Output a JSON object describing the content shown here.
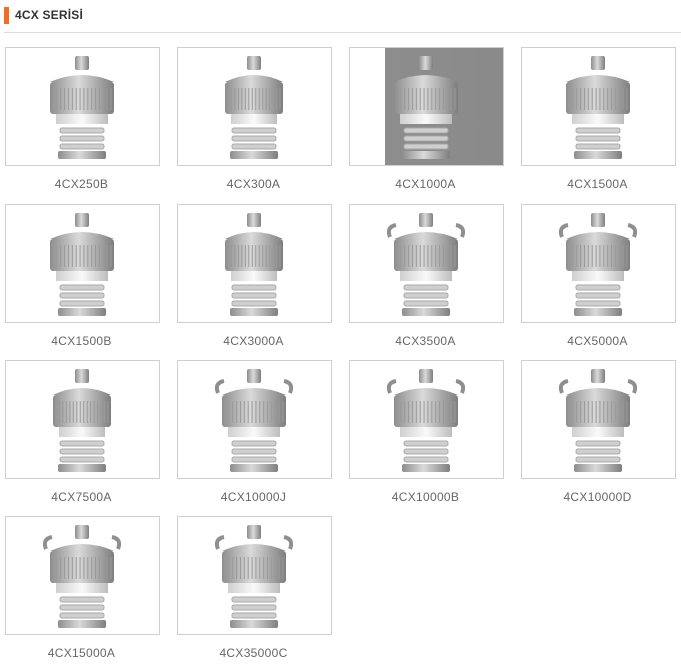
{
  "section": {
    "title": "4CX SERİSİ",
    "accent_color": "#f26c21"
  },
  "products": [
    {
      "name": "4CX250B",
      "icon": "tube-4cx250b-icon",
      "dark_bg": false
    },
    {
      "name": "4CX300A",
      "icon": "tube-4cx300a-icon",
      "dark_bg": false
    },
    {
      "name": "4CX1000A",
      "icon": "tube-4cx1000a-icon",
      "dark_bg": true
    },
    {
      "name": "4CX1500A",
      "icon": "tube-4cx1500a-icon",
      "dark_bg": false
    },
    {
      "name": "4CX1500B",
      "icon": "tube-4cx1500b-icon",
      "dark_bg": false
    },
    {
      "name": "4CX3000A",
      "icon": "tube-4cx3000a-icon",
      "dark_bg": false
    },
    {
      "name": "4CX3500A",
      "icon": "tube-4cx3500a-icon",
      "dark_bg": false
    },
    {
      "name": "4CX5000A",
      "icon": "tube-4cx5000a-icon",
      "dark_bg": false
    },
    {
      "name": "4CX7500A",
      "icon": "tube-4cx7500a-icon",
      "dark_bg": false
    },
    {
      "name": "4CX10000J",
      "icon": "tube-4cx10000j-icon",
      "dark_bg": false
    },
    {
      "name": "4CX10000B",
      "icon": "tube-4cx10000b-icon",
      "dark_bg": false
    },
    {
      "name": "4CX10000D",
      "icon": "tube-4cx10000d-icon",
      "dark_bg": false
    },
    {
      "name": "4CX15000A",
      "icon": "tube-4cx15000a-icon",
      "dark_bg": false
    },
    {
      "name": "4CX35000C",
      "icon": "tube-4cx35000c-icon",
      "dark_bg": false
    }
  ]
}
